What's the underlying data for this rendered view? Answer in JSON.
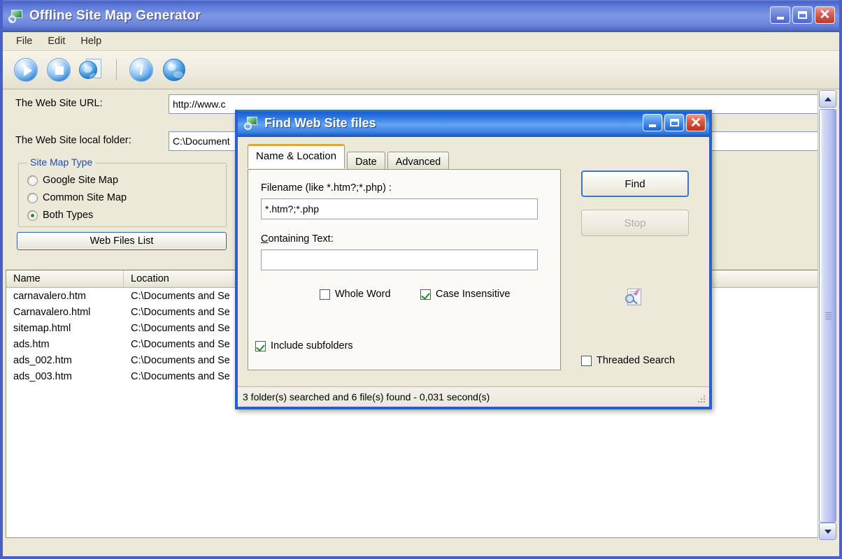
{
  "main_window": {
    "title": "Offline Site Map Generator",
    "title_icon": "sitemap-app-icon",
    "controls": {
      "minimize": "minimize-icon",
      "maximize": "maximize-icon",
      "close": "close-icon"
    },
    "menu": [
      {
        "label": "File"
      },
      {
        "label": "Edit"
      },
      {
        "label": "Help"
      }
    ],
    "toolbar": [
      {
        "name": "start-button",
        "icon": "play-icon"
      },
      {
        "name": "stop-button",
        "icon": "stop-icon"
      },
      {
        "name": "generate-sitemap-button",
        "icon": "globe-document-icon"
      },
      {
        "name": "about-button",
        "icon": "info-icon"
      },
      {
        "name": "open-web-button",
        "icon": "globe-icon"
      }
    ],
    "form": {
      "url_label": "The Web Site URL:",
      "url_value": "http://www.c",
      "url_placeholder": "http://",
      "folder_label": "The Web Site local folder:",
      "folder_value": "C:\\Document",
      "folder_placeholder": "C:\\",
      "sitemap_group_legend": "Site Map Type",
      "sitemap_options": [
        {
          "label": "Google Site Map",
          "selected": false
        },
        {
          "label": "Common Site Map",
          "selected": false
        },
        {
          "label": "Both Types",
          "selected": true
        }
      ],
      "web_files_list_button": "Web Files List"
    },
    "file_list": {
      "columns": [
        "Name",
        "Location"
      ],
      "rows": [
        {
          "name": "carnavalero.htm",
          "location": "C:\\Documents and Se"
        },
        {
          "name": "Carnavalero.html",
          "location": "C:\\Documents and Se"
        },
        {
          "name": "sitemap.html",
          "location": "C:\\Documents and Se"
        },
        {
          "name": "ads.htm",
          "location": "C:\\Documents and Se"
        },
        {
          "name": "ads_002.htm",
          "location": "C:\\Documents and Se"
        },
        {
          "name": "ads_003.htm",
          "location": "C:\\Documents and Se"
        }
      ]
    },
    "scrollbar": {
      "up_icon": "chevron-up-icon",
      "down_icon": "chevron-down-icon"
    }
  },
  "find_dialog": {
    "title": "Find Web Site files",
    "title_icon": "find-files-icon",
    "controls": {
      "minimize": "minimize-icon",
      "maximize": "maximize-icon",
      "close": "close-icon"
    },
    "tabs": [
      {
        "label": "Name & Location",
        "active": true
      },
      {
        "label": "Date",
        "active": false
      },
      {
        "label": "Advanced",
        "active": false
      }
    ],
    "filename_label": "Filename (like *.htm?;*.php) :",
    "filename_value": "*.htm?;*.php",
    "filename_placeholder": "*.*",
    "containing_text_label_accel": "C",
    "containing_text_label_rest": "ontaining Text:",
    "containing_text_value": "",
    "containing_text_placeholder": "",
    "checkboxes": [
      {
        "name": "whole-word",
        "label": "Whole Word",
        "checked": false
      },
      {
        "name": "case-insensitive",
        "label": "Case Insensitive",
        "checked": true
      },
      {
        "name": "include-subfolders",
        "label": "Include subfolders",
        "checked": true
      },
      {
        "name": "threaded-search",
        "label": "Threaded Search",
        "checked": false
      }
    ],
    "find_button": "Find",
    "stop_button": "Stop",
    "search_icon": "document-search-icon",
    "status_text": "3 folder(s) searched and 6 file(s) found - 0,031 second(s)",
    "resize_grip": "resize-grip-icon"
  },
  "colors": {
    "window_face": "#ece9d8",
    "main_title_blue": "#4a63c6",
    "dialog_title_blue": "#1b5fd4",
    "active_tab_accent": "#e8a33d",
    "group_legend_blue": "#1b4fa0",
    "check_green": "#1e8a1e",
    "radio_dot_green": "#2e8b2e",
    "close_red": "#bd2f1c",
    "default_button_border": "#3d76c8"
  }
}
